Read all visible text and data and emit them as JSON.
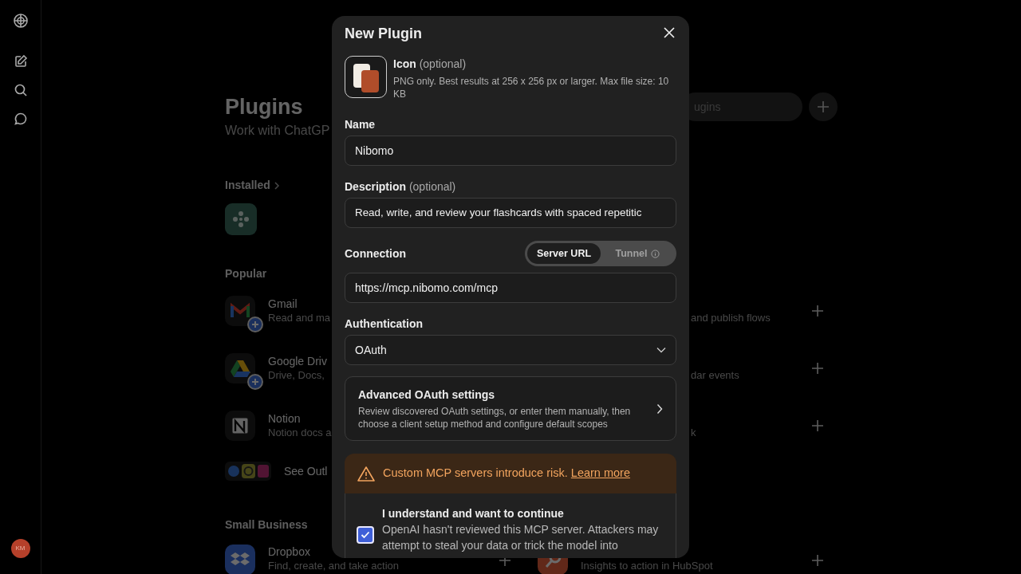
{
  "sidebar": {
    "avatar": "KM"
  },
  "page": {
    "title": "Plugins",
    "subtitle": "Work with ChatGP",
    "search_placeholder": "ugins",
    "installed_label": "Installed",
    "popular_label": "Popular",
    "popular": [
      {
        "kind": "gmail",
        "title": "Gmail",
        "desc": "Read and ma",
        "right_desc": "and publish flows",
        "badge": true
      },
      {
        "kind": "drive",
        "title": "Google Driv",
        "desc": "Drive, Docs,",
        "right_desc": "dar events",
        "badge": true
      },
      {
        "kind": "notion",
        "title": "Notion",
        "desc": "Notion docs a",
        "right_desc": "k",
        "badge": false
      }
    ],
    "see_more": "See Outl",
    "small_business_label": "Small Business",
    "small_business": [
      {
        "kind": "dropbox",
        "title": "Dropbox",
        "desc": "Find, create, and take action"
      },
      {
        "kind": "hubspot",
        "desc": "Insights to action in HubSpot"
      }
    ]
  },
  "dialog": {
    "title": "New Plugin",
    "icon_label": "Icon",
    "icon_optional": "(optional)",
    "icon_hint": "PNG only. Best results at 256 x 256 px or larger. Max file size: 10 KB",
    "name_label": "Name",
    "name_value": "Nibomo",
    "description_label": "Description",
    "description_optional": "(optional)",
    "description_value": "Read, write, and review your flashcards with spaced repetitic",
    "connection_label": "Connection",
    "connection_modes": [
      {
        "label": "Server URL",
        "selected": true
      },
      {
        "label": "Tunnel",
        "selected": false
      }
    ],
    "url_value": "https://mcp.nibomo.com/mcp",
    "auth_label": "Authentication",
    "auth_value": "OAuth",
    "advanced_title": "Advanced OAuth settings",
    "advanced_desc": "Review discovered OAuth settings, or enter them manually, then choose a client setup method and configure default scopes",
    "warning_text": "Custom MCP servers introduce risk.",
    "warning_link": "Learn more",
    "consent_title": "I understand and want to continue",
    "consent_desc": "OpenAI hasn't reviewed this MCP server. Attackers may attempt to steal your data or trick the model into",
    "consent_checked": true
  }
}
